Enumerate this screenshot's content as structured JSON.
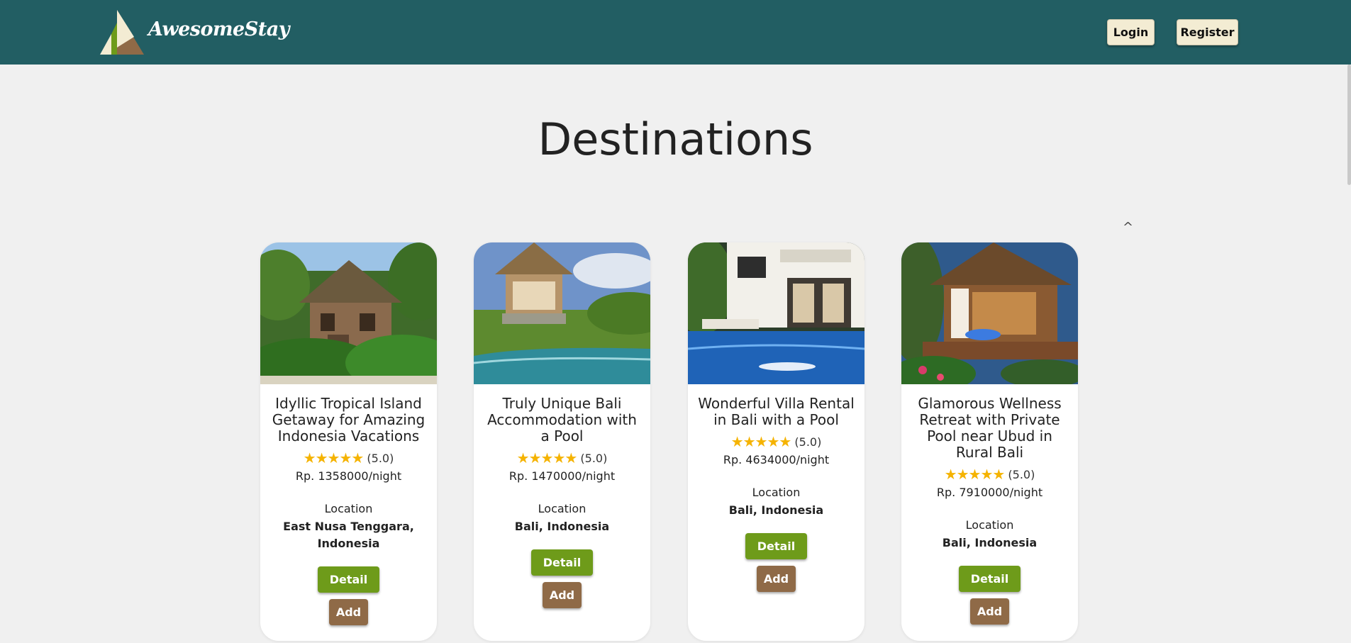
{
  "header": {
    "brand": "AwesomeStay",
    "login_label": "Login",
    "register_label": "Register"
  },
  "main": {
    "title": "Destinations",
    "collapse_icon": "^"
  },
  "cards": [
    {
      "title": "Idyllic Tropical Island Getaway for Amazing Indonesia Vacations",
      "stars": "★★★★★",
      "rating": "(5.0)",
      "price": "Rp. 1358000/night",
      "location_label": "Location",
      "location": "East Nusa Tenggara, Indonesia",
      "detail_label": "Detail",
      "add_label": "Add"
    },
    {
      "title": "Truly Unique Bali Accommodation with a Pool",
      "stars": "★★★★★",
      "rating": "(5.0)",
      "price": "Rp. 1470000/night",
      "location_label": "Location",
      "location": "Bali, Indonesia",
      "detail_label": "Detail",
      "add_label": "Add"
    },
    {
      "title": "Wonderful Villa Rental in Bali with a Pool",
      "stars": "★★★★★",
      "rating": "(5.0)",
      "price": "Rp. 4634000/night",
      "location_label": "Location",
      "location": "Bali, Indonesia",
      "detail_label": "Detail",
      "add_label": "Add"
    },
    {
      "title": "Glamorous Wellness Retreat with Private Pool near Ubud in Rural Bali",
      "stars": "★★★★★",
      "rating": "(5.0)",
      "price": "Rp. 7910000/night",
      "location_label": "Location",
      "location": "Bali, Indonesia",
      "detail_label": "Detail",
      "add_label": "Add"
    }
  ],
  "colors": {
    "navbar": "#225e63",
    "nav_button": "#f3ecd3",
    "detail_button": "#6e9b1a",
    "add_button": "#8f6a47",
    "star": "#f5b301",
    "page_background": "#f0f0f0"
  }
}
